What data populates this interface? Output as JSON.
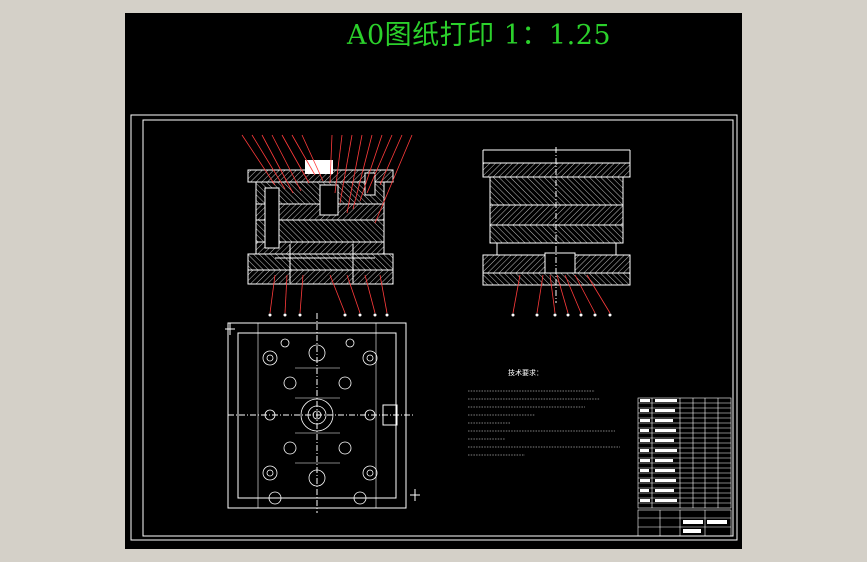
{
  "print_title": "A0图纸打印 1：1.25",
  "notes": {
    "heading": "技术要求："
  },
  "colors": {
    "background": "#000000",
    "outer_frame": "#d4d0c8",
    "title_text": "#2bd02b",
    "lines": "#ffffff",
    "leader_lines": "#ff3b3b",
    "hatch": "#c8c8c8"
  }
}
